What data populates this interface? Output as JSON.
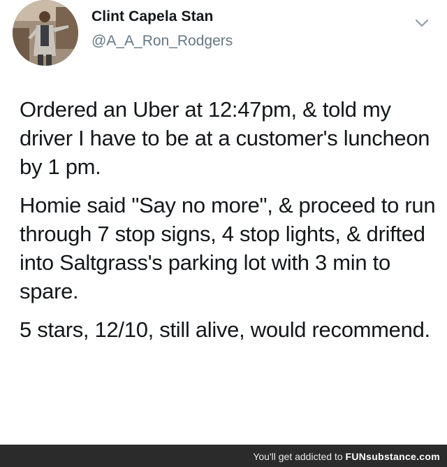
{
  "tweet": {
    "display_name": "Clint Capela Stan",
    "handle": "@A_A_Ron_Rodgers",
    "paragraphs": [
      "Ordered an Uber at 12:47pm, & told my driver I have to be at a customer's luncheon by 1 pm.",
      "Homie said \"Say no more\", & proceed to run through 7 stop signs, 4 stop lights, & drifted into Saltgrass's parking lot with 3 min to spare.",
      "5 stars, 12/10, still alive, would recommend."
    ],
    "menu_icon": "chevron-down-icon",
    "avatar_icon": "avatar-photo"
  },
  "footer": {
    "tagline": "You'll get addicted to ",
    "brand": "FUNsubstance.com"
  },
  "colors": {
    "text": "#14171a",
    "secondary": "#657786",
    "footer_bg": "#2b2b2b"
  }
}
